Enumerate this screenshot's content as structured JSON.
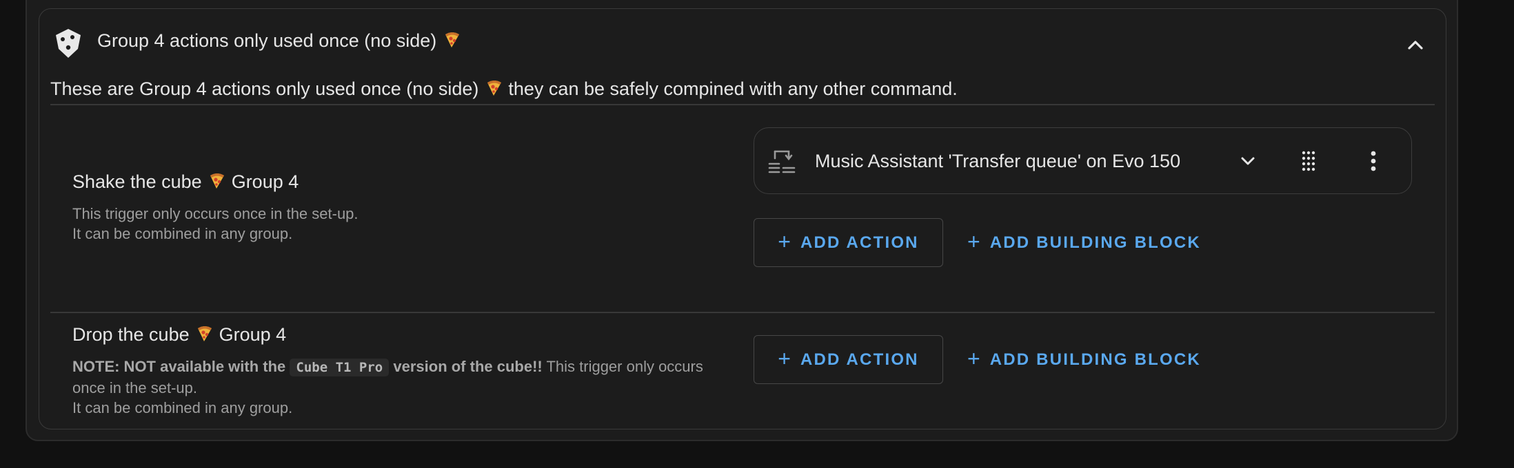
{
  "section": {
    "title": "Group 4 actions only used once (no side)",
    "title_emoji": "🍕",
    "description_before": "These are Group 4 actions only used once (no side)",
    "description_after": "they can be safely compined with any other command.",
    "icon": "dice-icon",
    "collapse_icon": "chevron-up-icon"
  },
  "triggers": [
    {
      "name_before": "Shake the cube",
      "name_after": "Group 4",
      "desc_line1": "This trigger only occurs once in the set-up.",
      "desc_line2": "It can be combined in any group.",
      "action": {
        "title": "Music Assistant 'Transfer queue' on Evo 150",
        "icon": "queue-transfer-icon",
        "expand_icon": "chevron-down-icon",
        "drag_icon": "drag-handle-icon",
        "menu_icon": "more-vertical-icon"
      },
      "add_action_label": "ADD ACTION",
      "add_block_label": "ADD BUILDING BLOCK"
    },
    {
      "name_before": "Drop the cube",
      "name_after": "Group 4",
      "note_bold_1": "NOTE: NOT available with the",
      "note_code": "Cube T1 Pro",
      "note_bold_2": "version of the cube!!",
      "note_rest": "This trigger only occurs once in the set-up.",
      "desc_line2": "It can be combined in any group.",
      "add_action_label": "ADD ACTION",
      "add_block_label": "ADD BUILDING BLOCK"
    }
  ],
  "colors": {
    "accent": "#5aa8ee",
    "background": "#111111",
    "card": "#1c1c1c",
    "text_primary": "#e6e6e6",
    "text_secondary": "#9e9e9e"
  }
}
